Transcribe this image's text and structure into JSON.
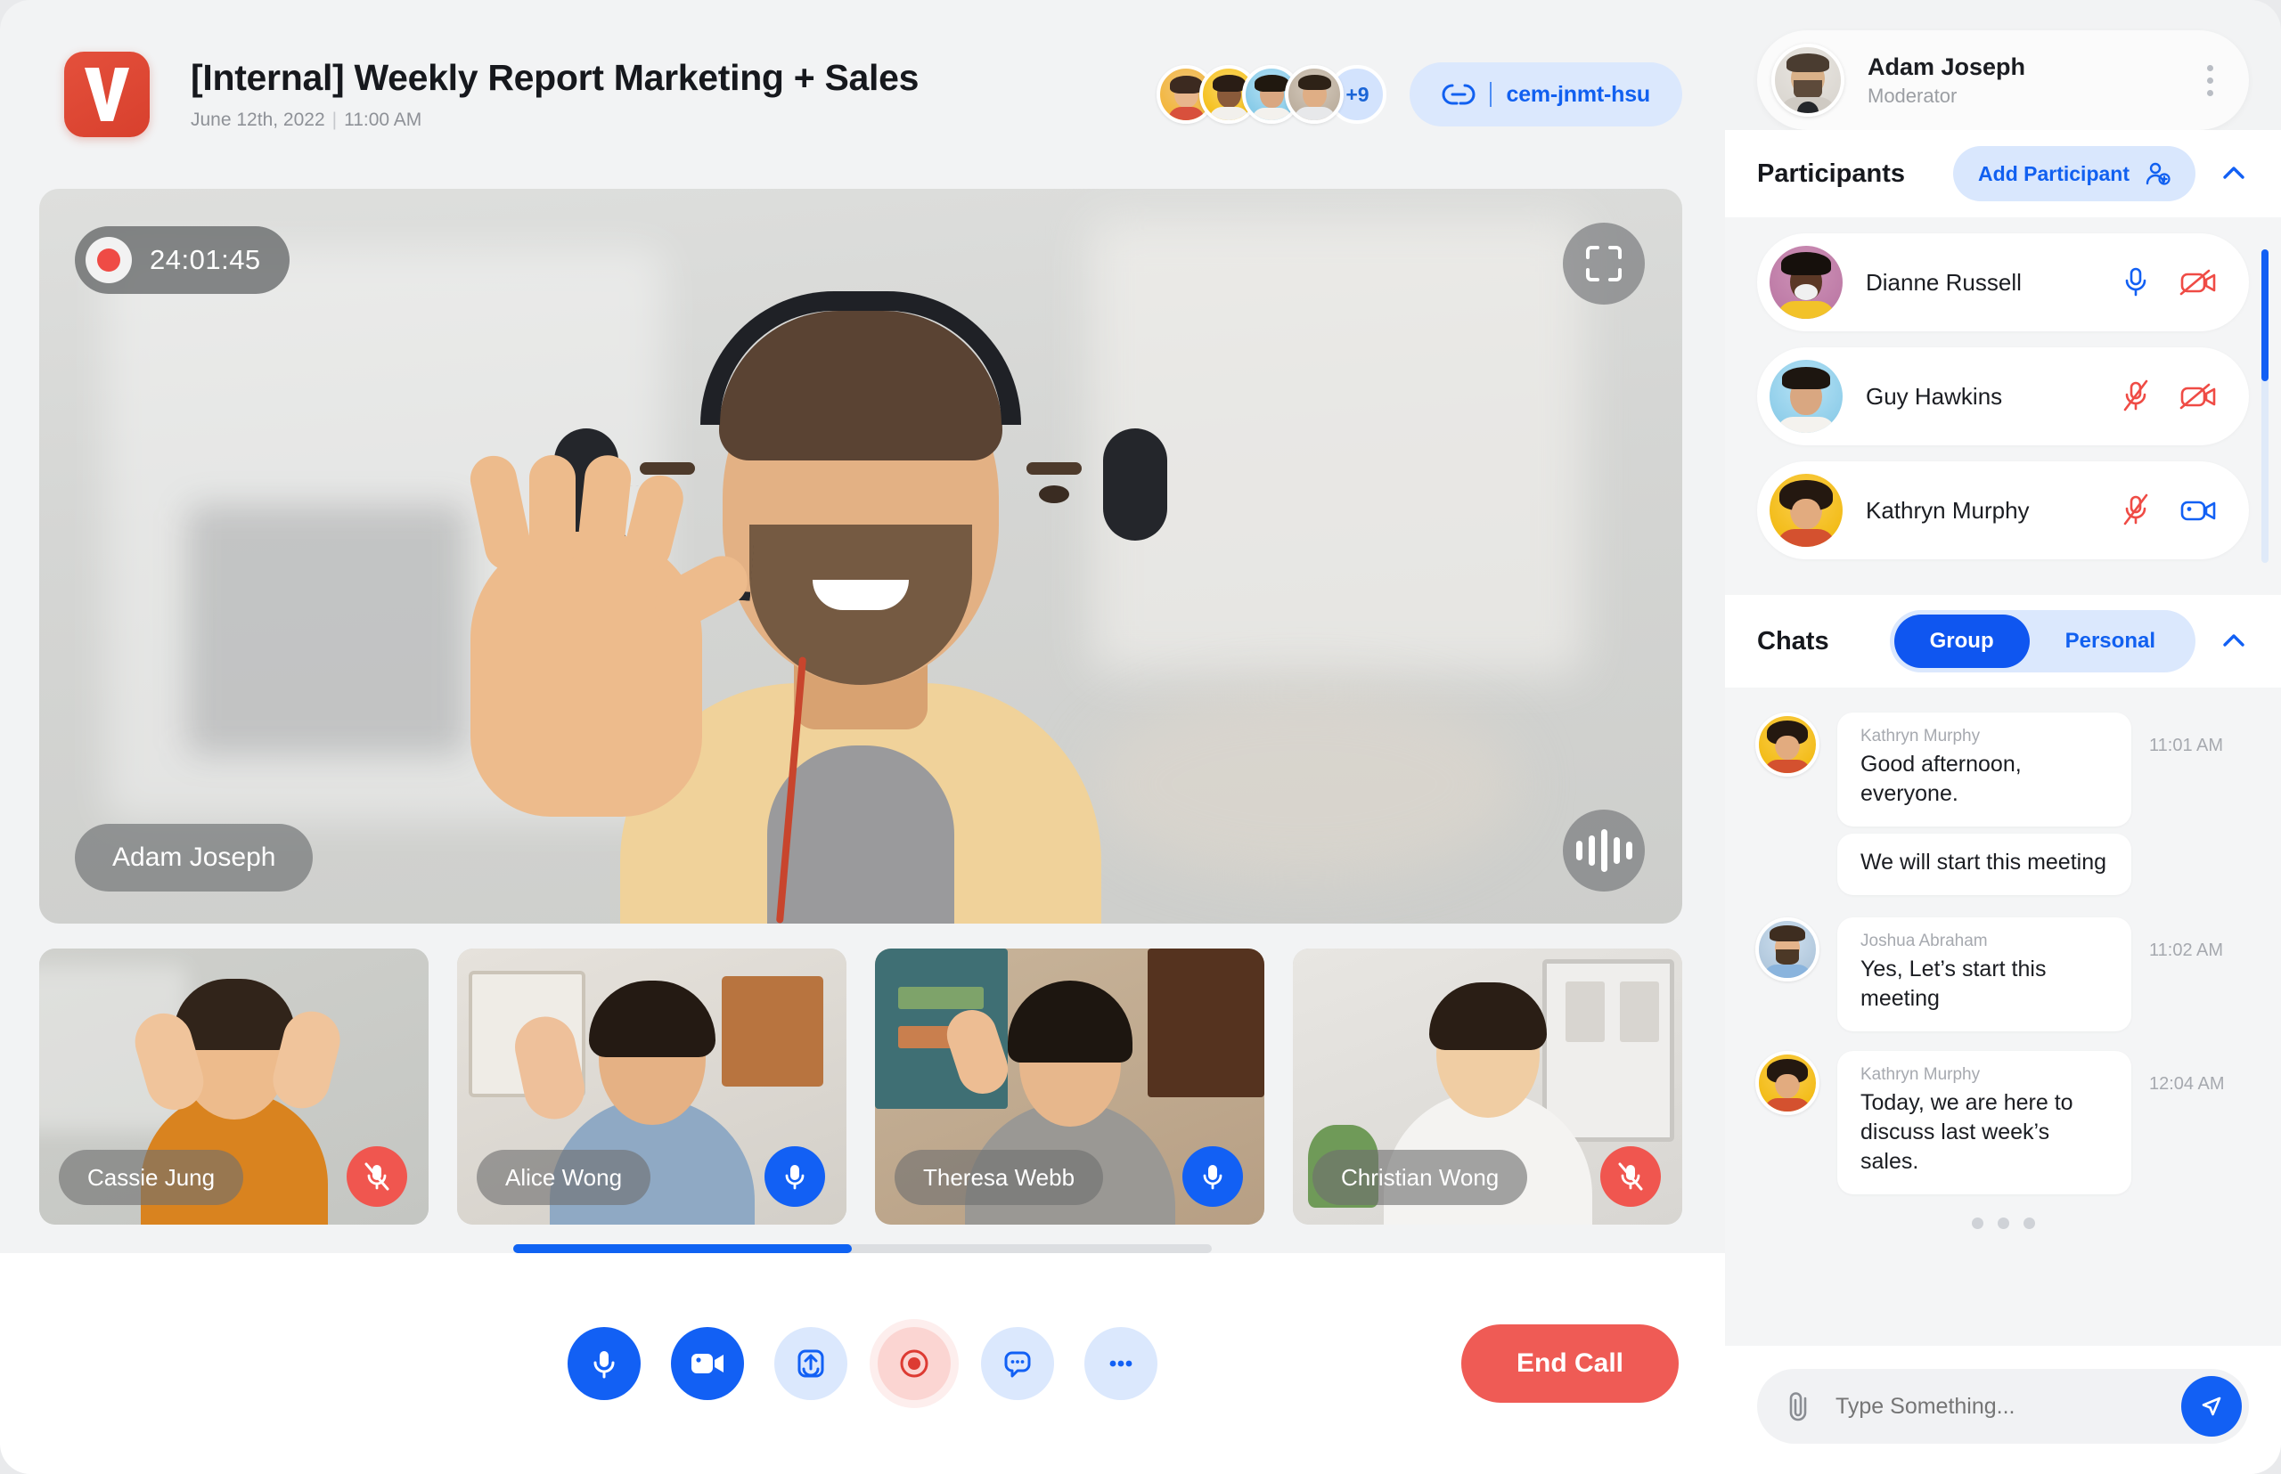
{
  "header": {
    "logo_icon": "vidzy-v-logo",
    "title": "[Internal] Weekly Report Marketing + Sales",
    "date": "June 12th, 2022",
    "separator": "|",
    "time": "11:00 AM",
    "avatar_overflow": "+9",
    "link_icon": "link-icon",
    "meeting_code": "cem-jnmt-hsu"
  },
  "stage": {
    "recording_time": "24:01:45",
    "record_icon": "record-dot-icon",
    "fullscreen_icon": "fullscreen-icon",
    "waveform_icon": "audio-waveform-icon",
    "active_speaker": "Adam Joseph"
  },
  "thumbnails": [
    {
      "name": "Cassie Jung",
      "mic": "off",
      "mic_icon": "mic-off-icon"
    },
    {
      "name": "Alice Wong",
      "mic": "on",
      "mic_icon": "mic-on-icon"
    },
    {
      "name": "Theresa Webb",
      "mic": "on",
      "mic_icon": "mic-on-icon"
    },
    {
      "name": "Christian Wong",
      "mic": "off",
      "mic_icon": "mic-off-icon"
    }
  ],
  "controls": {
    "buttons": [
      {
        "name": "microphone",
        "icon": "mic-on-icon",
        "style": "solid"
      },
      {
        "name": "camera",
        "icon": "video-on-icon",
        "style": "solid"
      },
      {
        "name": "share",
        "icon": "share-screen-icon",
        "style": "light"
      },
      {
        "name": "record",
        "icon": "record-icon",
        "style": "rec"
      },
      {
        "name": "chat",
        "icon": "chat-bubble-icon",
        "style": "light"
      },
      {
        "name": "more",
        "icon": "more-dots-icon",
        "style": "light"
      }
    ],
    "end_call_label": "End Call"
  },
  "sidebar": {
    "profile": {
      "name": "Adam Joseph",
      "role": "Moderator",
      "menu_icon": "kebab-menu-icon",
      "avatar": "avatar-adam-joseph"
    },
    "participants_section": {
      "title": "Participants",
      "add_label": "Add Participant",
      "add_icon": "add-user-icon",
      "collapse_icon": "chevron-up-icon",
      "rows": [
        {
          "name": "Dianne Russell",
          "mic": "on",
          "video": "off",
          "mic_icon": "mic-on-icon",
          "video_icon": "video-off-icon"
        },
        {
          "name": "Guy Hawkins",
          "mic": "off",
          "video": "off",
          "mic_icon": "mic-off-icon",
          "video_icon": "video-off-icon"
        },
        {
          "name": "Kathryn Murphy",
          "mic": "off",
          "video": "on",
          "mic_icon": "mic-off-icon",
          "video_icon": "video-on-icon"
        }
      ]
    },
    "chats_section": {
      "title": "Chats",
      "tabs": [
        {
          "label": "Group",
          "active": true
        },
        {
          "label": "Personal",
          "active": false
        }
      ],
      "collapse_icon": "chevron-up-icon",
      "messages": [
        {
          "sender": "Kathryn Murphy",
          "text": "Good afternoon, everyone.",
          "time": "11:01 AM",
          "show_avatar": true,
          "show_sender": true
        },
        {
          "sender": "Kathryn Murphy",
          "text": "We will start this meeting",
          "time": "",
          "show_avatar": false,
          "show_sender": false
        },
        {
          "sender": "Joshua Abraham",
          "text": "Yes, Let’s start this meeting",
          "time": "11:02 AM",
          "show_avatar": true,
          "show_sender": true
        },
        {
          "sender": "Kathryn Murphy",
          "text": "Today, we are here to discuss last week’s sales.",
          "time": "12:04 AM",
          "show_avatar": true,
          "show_sender": true
        }
      ],
      "pagination_dots": 3
    },
    "composer": {
      "attach_icon": "attachment-icon",
      "placeholder": "Type Something...",
      "send_icon": "send-icon"
    }
  },
  "colors": {
    "primary_blue": "#1260f4",
    "light_blue": "#dbe8fd",
    "danger_red": "#ef5b55",
    "mute_red": "#f0564f",
    "panel_bg": "#f2f3f4",
    "white": "#ffffff"
  }
}
